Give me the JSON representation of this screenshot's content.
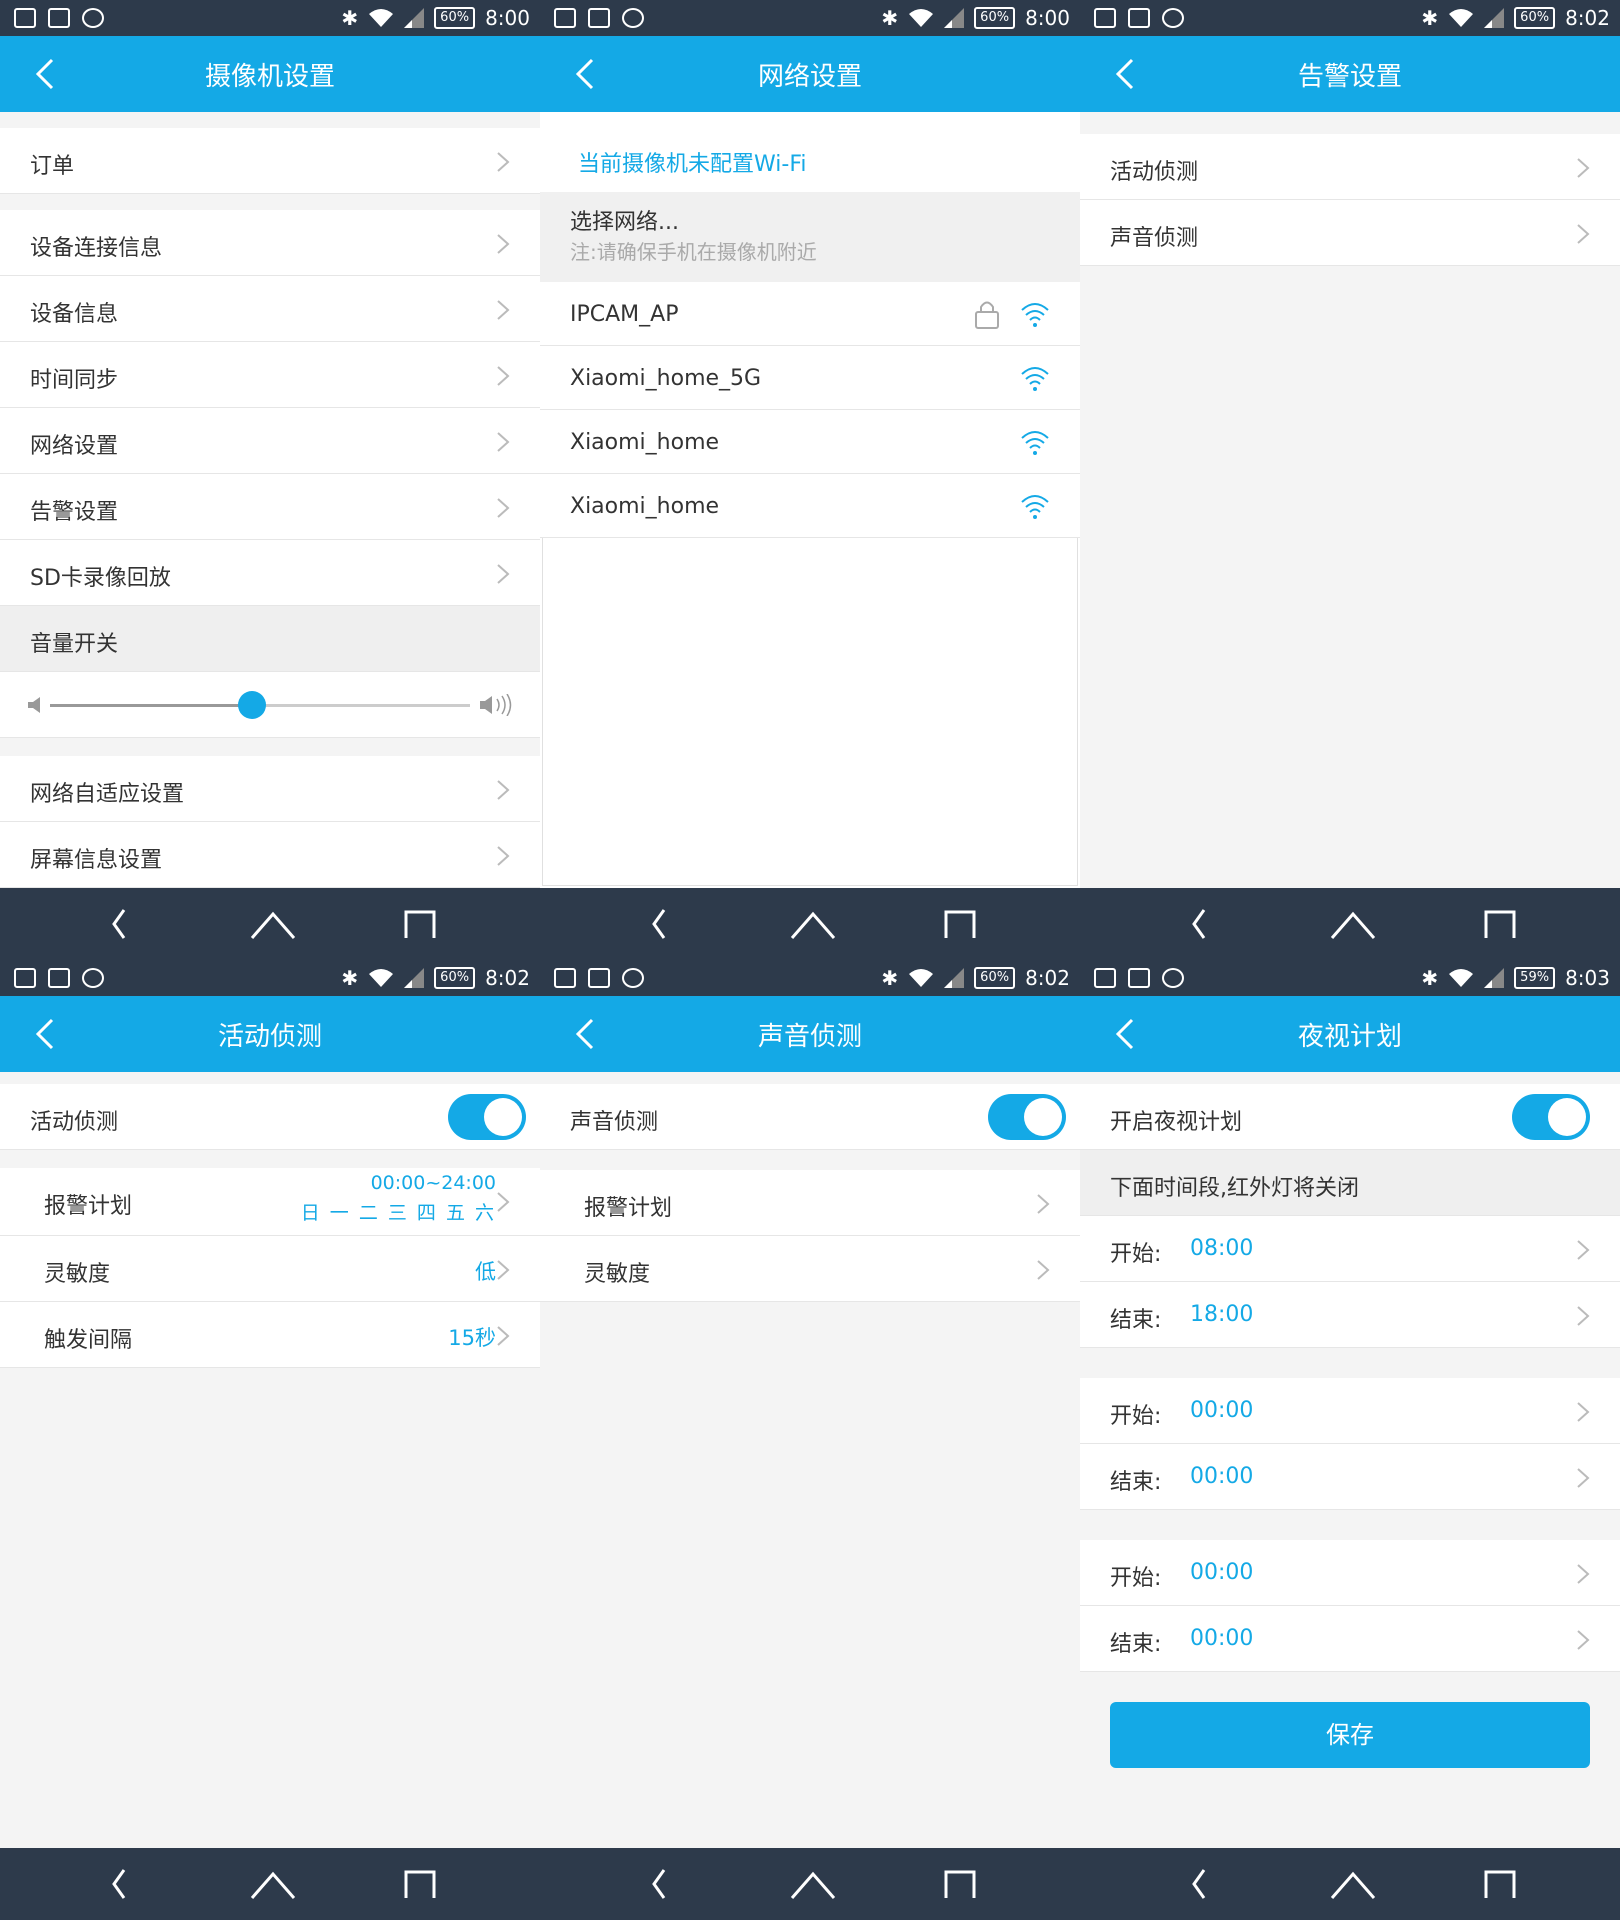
{
  "screens": [
    {
      "time": "8:00",
      "battery": "60%",
      "title": "摄像机设置",
      "items": [
        {
          "label": "订单"
        },
        {
          "label": "设备连接信息"
        },
        {
          "label": "设备信息"
        },
        {
          "label": "时间同步"
        },
        {
          "label": "网络设置"
        },
        {
          "label": "告警设置"
        },
        {
          "label": "SD卡录像回放"
        }
      ],
      "volume_label": "音量开关",
      "volume_level": 0.48,
      "items2": [
        {
          "label": "网络自适应设置"
        },
        {
          "label": "屏幕信息设置"
        }
      ]
    },
    {
      "time": "8:00",
      "battery": "60%",
      "title": "网络设置",
      "status": "当前摄像机未配置Wi-Fi",
      "choose": "选择网络...",
      "note": "注:请确保手机在摄像机附近",
      "networks": [
        {
          "ssid": "IPCAM_AP",
          "locked": true
        },
        {
          "ssid": "Xiaomi_home_5G",
          "locked": false
        },
        {
          "ssid": "Xiaomi_home",
          "locked": false
        },
        {
          "ssid": "Xiaomi_home",
          "locked": false
        }
      ]
    },
    {
      "time": "8:02",
      "battery": "60%",
      "title": "告警设置",
      "items": [
        {
          "label": "活动侦测"
        },
        {
          "label": "声音侦测"
        }
      ]
    },
    {
      "time": "8:02",
      "battery": "60%",
      "title": "活动侦测",
      "toggle_label": "活动侦测",
      "toggle_on": true,
      "schedule_label": "报警计划",
      "schedule_time": "00:00~24:00",
      "schedule_days": "日 一 二 三 四 五 六",
      "sensitivity_label": "灵敏度",
      "sensitivity_value": "低",
      "interval_label": "触发间隔",
      "interval_value": "15秒"
    },
    {
      "time": "8:02",
      "battery": "60%",
      "title": "声音侦测",
      "toggle_label": "声音侦测",
      "toggle_on": true,
      "schedule_label": "报警计划",
      "sensitivity_label": "灵敏度"
    },
    {
      "time": "8:03",
      "battery": "59%",
      "title": "夜视计划",
      "toggle_label": "开启夜视计划",
      "toggle_on": true,
      "hint": "下面时间段,红外灯将关闭",
      "start_label": "开始:",
      "end_label": "结束:",
      "slots": [
        {
          "start": "08:00",
          "end": "18:00"
        },
        {
          "start": "00:00",
          "end": "00:00"
        },
        {
          "start": "00:00",
          "end": "00:00"
        }
      ],
      "save": "保存"
    }
  ],
  "colors": {
    "accent": "#14a9e6",
    "bar": "#2d3a4b"
  }
}
